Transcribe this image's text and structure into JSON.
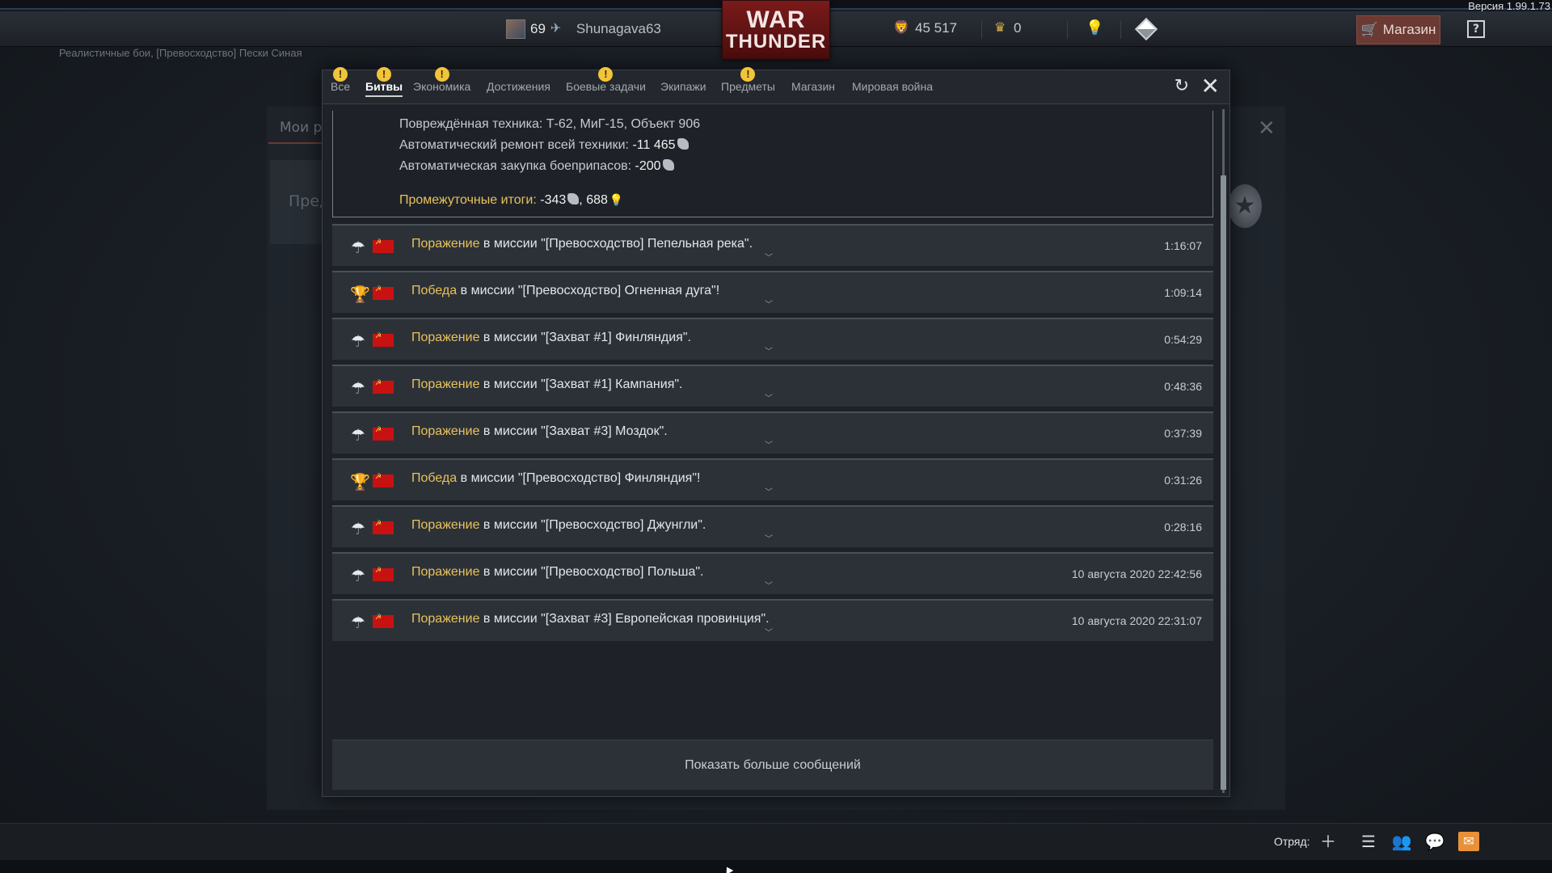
{
  "app": {
    "version": "Версия 1.99.1.73",
    "logo_line1": "WAR",
    "logo_line2": "THUNDER"
  },
  "header": {
    "player_level": "69",
    "player_name": "Shunagava63",
    "silver_lions": "45 517",
    "golden_eagles": "0",
    "shop_label": "Магазин",
    "help_label": "?"
  },
  "background": {
    "mission_crumb": "Реалистичные бои, [Превосходство] Пески Синая",
    "tab_label": "Мои ро",
    "card_text": "Пред"
  },
  "modal": {
    "tabs": [
      {
        "label": "Все",
        "badge": "!"
      },
      {
        "label": "Битвы",
        "badge": "!"
      },
      {
        "label": "Экономика",
        "badge": "!"
      },
      {
        "label": "Достижения",
        "badge": ""
      },
      {
        "label": "Боевые задачи",
        "badge": "!"
      },
      {
        "label": "Экипажи",
        "badge": ""
      },
      {
        "label": "Предметы",
        "badge": "!"
      },
      {
        "label": "Магазин",
        "badge": ""
      },
      {
        "label": "Мировая война",
        "badge": ""
      }
    ],
    "active_tab": "Битвы",
    "summary": {
      "damaged_label": "Повреждённая техника: ",
      "damaged_value": "Т-62, МиГ-15, Объект 906",
      "repair_label": "Автоматический ремонт всей техники: ",
      "repair_value": "-11 465",
      "ammo_label": "Автоматическая закупка боеприпасов: ",
      "ammo_value": "-200",
      "subtotal_label": "Промежуточные итоги: ",
      "subtotal_lions": "-343",
      "subtotal_sep": ", ",
      "subtotal_rp": "688"
    },
    "battles": [
      {
        "result": "Поражение",
        "text": " в миссии \"[Превосходство] Пепельная река\".",
        "time": "1:16:07",
        "icon": "parachute-icon"
      },
      {
        "result": "Победа",
        "text": " в миссии \"[Превосходство] Огненная дуга\"!",
        "time": "1:09:14",
        "icon": "trophy-icon"
      },
      {
        "result": "Поражение",
        "text": " в миссии \"[Захват #1] Финляндия\".",
        "time": "0:54:29",
        "icon": "parachute-icon"
      },
      {
        "result": "Поражение",
        "text": " в миссии \"[Захват #1] Кампания\".",
        "time": "0:48:36",
        "icon": "parachute-icon"
      },
      {
        "result": "Поражение",
        "text": " в миссии \"[Захват #3] Моздок\".",
        "time": "0:37:39",
        "icon": "parachute-icon"
      },
      {
        "result": "Победа",
        "text": " в миссии \"[Превосходство] Финляндия\"!",
        "time": "0:31:26",
        "icon": "trophy-icon"
      },
      {
        "result": "Поражение",
        "text": " в миссии \"[Превосходство] Джунгли\".",
        "time": "0:28:16",
        "icon": "parachute-icon"
      },
      {
        "result": "Поражение",
        "text": " в миссии \"[Превосходство] Польша\".",
        "time": "10 августа 2020 22:42:56",
        "icon": "parachute-icon"
      },
      {
        "result": "Поражение",
        "text": " в миссии \"[Захват #3] Европейская провинция\".",
        "time": "10 августа 2020 22:31:07",
        "icon": "parachute-icon"
      }
    ],
    "show_more_label": "Показать больше сообщений"
  },
  "footer": {
    "squad_label": "Отряд:"
  },
  "colors": {
    "accent_yellow": "#e8c25a",
    "badge_yellow": "#f2c439",
    "brand_red": "#7a1a1a",
    "mail_orange": "#e8913a"
  }
}
